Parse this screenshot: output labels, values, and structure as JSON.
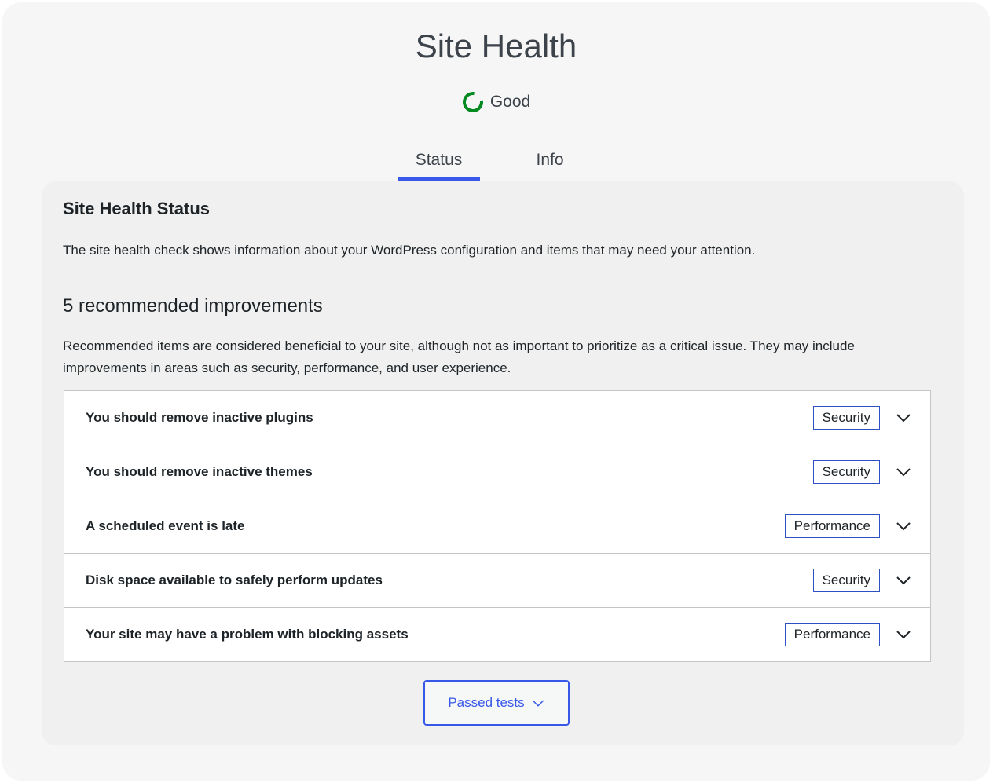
{
  "header": {
    "title": "Site Health",
    "status_label": "Good",
    "status_color": "#008a20"
  },
  "tabs": [
    {
      "label": "Status",
      "active": true
    },
    {
      "label": "Info",
      "active": false
    }
  ],
  "card": {
    "title": "Site Health Status",
    "description": "The site health check shows information about your WordPress configuration and items that may need your attention.",
    "count_title": "5 recommended improvements",
    "count_description": "Recommended items are considered beneficial to your site, although not as important to prioritize as a critical issue. They may include improvements in areas such as security, performance, and user experience."
  },
  "issues": [
    {
      "label": "You should remove inactive plugins",
      "badge": "Security",
      "icon": "chevron-down-icon"
    },
    {
      "label": "You should remove inactive themes",
      "badge": "Security",
      "icon": "chevron-down-icon"
    },
    {
      "label": "A scheduled event is late",
      "badge": "Performance",
      "icon": "chevron-down-icon"
    },
    {
      "label": "Disk space available to safely perform updates",
      "badge": "Security",
      "icon": "chevron-down-icon"
    },
    {
      "label": "Your site may have a problem with blocking assets",
      "badge": "Performance",
      "icon": "chevron-down-icon"
    }
  ],
  "passed_button": {
    "label": "Passed tests",
    "icon": "chevron-down-icon"
  },
  "colors": {
    "accent": "#3858e9",
    "good": "#008a20"
  }
}
